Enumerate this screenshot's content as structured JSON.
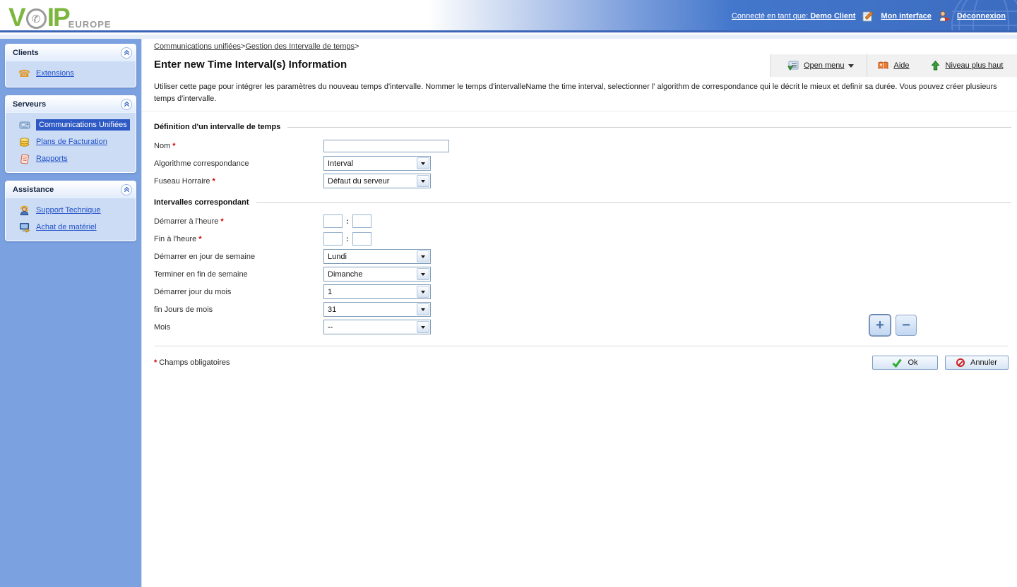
{
  "brand": {
    "part_v": "V",
    "part_ip": "IP",
    "europe": "EUROPE",
    "phone_glyph": "✆"
  },
  "header": {
    "connected_prefix": "Connecté en tant que:",
    "connected_user": "Demo Client",
    "mon_interface": "Mon interface",
    "deconnexion": "Déconnexion"
  },
  "sidebar": {
    "sections": [
      {
        "title": "Clients",
        "items": [
          {
            "label": "Extensions",
            "icon": "phone-icon"
          }
        ]
      },
      {
        "title": "Serveurs",
        "items": [
          {
            "label": "Communications Unifiées",
            "icon": "unified-comms-icon",
            "selected": true
          },
          {
            "label": "Plans de Facturation",
            "icon": "coins-icon"
          },
          {
            "label": "Rapports",
            "icon": "report-icon"
          }
        ]
      },
      {
        "title": "Assistance",
        "items": [
          {
            "label": "Support Technique",
            "icon": "support-agent-icon"
          },
          {
            "label": "Achat de matériel",
            "icon": "hardware-monitor-icon"
          }
        ]
      }
    ]
  },
  "breadcrumb": {
    "items": [
      "Communications unifiées",
      "Gestion des Intervalle de temps"
    ],
    "separator": ">"
  },
  "toolbar": {
    "open_menu": "Open menu",
    "aide": "Aide",
    "niveau_plus_haut": "Niveau plus haut"
  },
  "page": {
    "title": "Enter new Time Interval(s) Information",
    "description": "Utiliser cette page pour intégrer les paramètres du nouveau temps d'intervalle. Nommer le temps d'intervalleName the time interval, selectionner l' algorithm de correspondance qui le décrit le mieux et definir sa durée. Vous pouvez créer plusieurs temps d'intervalle."
  },
  "form": {
    "required_marker": "*",
    "time_separator": ":",
    "definition": {
      "title": "Définition d'un intervalle de temps",
      "nom_label": "Nom",
      "algorithme_label": "Algorithme correspondance",
      "algorithme_value": "Interval",
      "fuseau_label": "Fuseau Horraire",
      "fuseau_value": "Défaut du serveur"
    },
    "intervalles": {
      "title": "Intervalles correspondant",
      "demarrer_heure_label": "Démarrer à l'heure",
      "fin_heure_label": "Fin à l'heure",
      "demarrer_jour_semaine_label": "Démarrer en jour de semaine",
      "demarrer_jour_semaine_value": "Lundi",
      "terminer_fin_semaine_label": "Terminer en fin de semaine",
      "terminer_fin_semaine_value": "Dimanche",
      "demarrer_jour_mois_label": "Démarrer jour du mois",
      "demarrer_jour_mois_value": "1",
      "fin_jours_mois_label": "fin Jours de mois",
      "fin_jours_mois_value": "31",
      "mois_label": "Mois",
      "mois_value": "--"
    },
    "add_button": "+",
    "remove_button": "−",
    "required_note": "Champs obligatoires",
    "ok_button": "Ok",
    "cancel_button": "Annuler"
  },
  "colors": {
    "header_blue": "#3c6cc0",
    "sidebar_bg": "#7ba1e0",
    "selected_item_bg": "#2d59c4",
    "link_blue": "#2050c8",
    "required_red": "#cc0000",
    "ok_green": "#2fa832",
    "cancel_red": "#cc2222",
    "logo_green": "#7cb63e"
  }
}
